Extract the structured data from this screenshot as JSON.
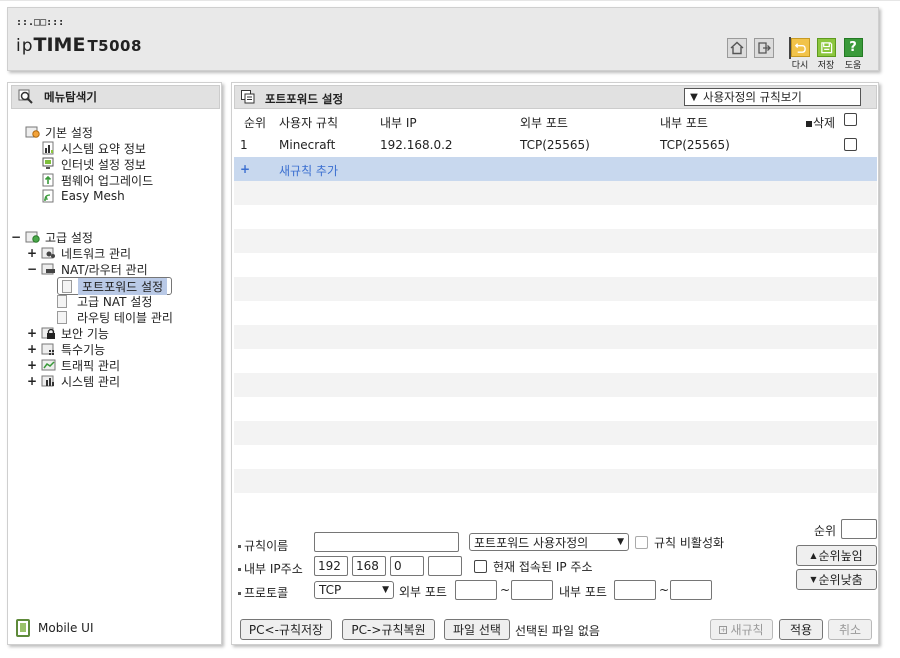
{
  "header": {
    "logo_dots": "::.□□:::",
    "logo_ip": "ip",
    "logo_time": "TIME",
    "logo_model": "T5008",
    "buttons": [
      {
        "label": "다시",
        "icon": "undo-icon",
        "color": "#f2c34a"
      },
      {
        "label": "저장",
        "icon": "save-icon",
        "color": "#8cc63e"
      },
      {
        "label": "도움",
        "icon": "help-icon",
        "color": "#3a9a3a"
      }
    ],
    "home_icon": "home-icon",
    "logout_icon": "logout-icon"
  },
  "sidebar": {
    "title": "메뉴탐색기",
    "groups": [
      {
        "label": "기본 설정",
        "items": [
          "시스템 요약 정보",
          "인터넷 설정 정보",
          "펌웨어 업그레이드",
          "Easy Mesh"
        ]
      },
      {
        "label": "고급 설정",
        "items": [
          {
            "label": "네트워크 관리",
            "toggle": "+"
          },
          {
            "label": "NAT/라우터 관리",
            "toggle": "−",
            "children": [
              "포트포워드 설정",
              "고급 NAT 설정",
              "라우팅 테이블 관리"
            ]
          },
          {
            "label": "보안 기능",
            "toggle": "+"
          },
          {
            "label": "특수기능",
            "toggle": "+"
          },
          {
            "label": "트래픽 관리",
            "toggle": "+"
          },
          {
            "label": "시스템 관리",
            "toggle": "+"
          }
        ]
      }
    ],
    "collapse_toggle": "−",
    "mobile_ui": "Mobile UI"
  },
  "main": {
    "title": "포트포워드 설정",
    "view_select": "사용자정의 규칙보기",
    "columns": [
      "순위",
      "사용자 규칙",
      "내부 IP",
      "외부 포트",
      "내부 포트",
      "삭제"
    ],
    "rows": [
      {
        "rank": "1",
        "rule": "Minecraft",
        "ip": "192.168.0.2",
        "ext_port": "TCP(25565)",
        "int_port": "TCP(25565)"
      }
    ],
    "add_row": {
      "plus": "+",
      "label": "새규칙 추가"
    }
  },
  "form": {
    "rule_name_label": "규칙이름",
    "rule_name_value": "",
    "preset_select": "포트포워드 사용자정의",
    "disable_label": "규칙 비활성화",
    "rank_label": "순위",
    "rank_value": "",
    "ip_label": "내부 IP주소",
    "ip1": "192",
    "ip2": "168",
    "ip3": "0",
    "ip4": "",
    "current_ip_label": "현재 접속된 IP 주소",
    "rank_up": "순위높임",
    "rank_down": "순위낮춤",
    "protocol_label": "프로토콜",
    "protocol_value": "TCP",
    "ext_port_label": "외부 포트",
    "int_port_label": "내부 포트",
    "tilde": "~",
    "btn_save_pc": "PC<-규칙저장",
    "btn_restore_pc": "PC->규칙복원",
    "btn_file": "파일 선택",
    "file_status": "선택된 파일 없음",
    "btn_new_rule": "새규칙",
    "btn_apply": "적용",
    "btn_cancel": "취소"
  }
}
